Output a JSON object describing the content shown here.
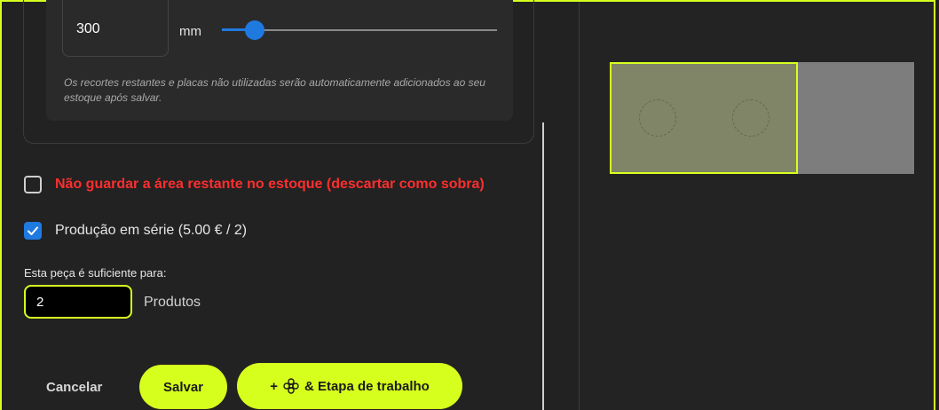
{
  "length": {
    "value": "300",
    "unit": "mm",
    "slider_fraction": 0.12
  },
  "note": "Os recortes restantes e placas não utilizadas serão automaticamente adicionados ao seu estoque após salvar.",
  "options": {
    "discard_label": "Não guardar a área restante no estoque (descartar como sobra)",
    "discard_checked": false,
    "series_label": "Produção em série (5.00 € / 2)",
    "series_checked": true
  },
  "quantity": {
    "label": "Esta peça é suficiente para:",
    "value": "2",
    "unit": "Produtos"
  },
  "actions": {
    "cancel": "Cancelar",
    "save": "Salvar",
    "add_step_prefix": "+",
    "add_step": "& Etapa de trabalho"
  },
  "colors": {
    "accent": "#d7ff1e",
    "primary": "#1f7ae0",
    "danger": "#ff2e2e",
    "background": "#1f1f1f"
  },
  "icons": {
    "checkbox_checked": "check-icon",
    "add_step": "flower-icon"
  }
}
